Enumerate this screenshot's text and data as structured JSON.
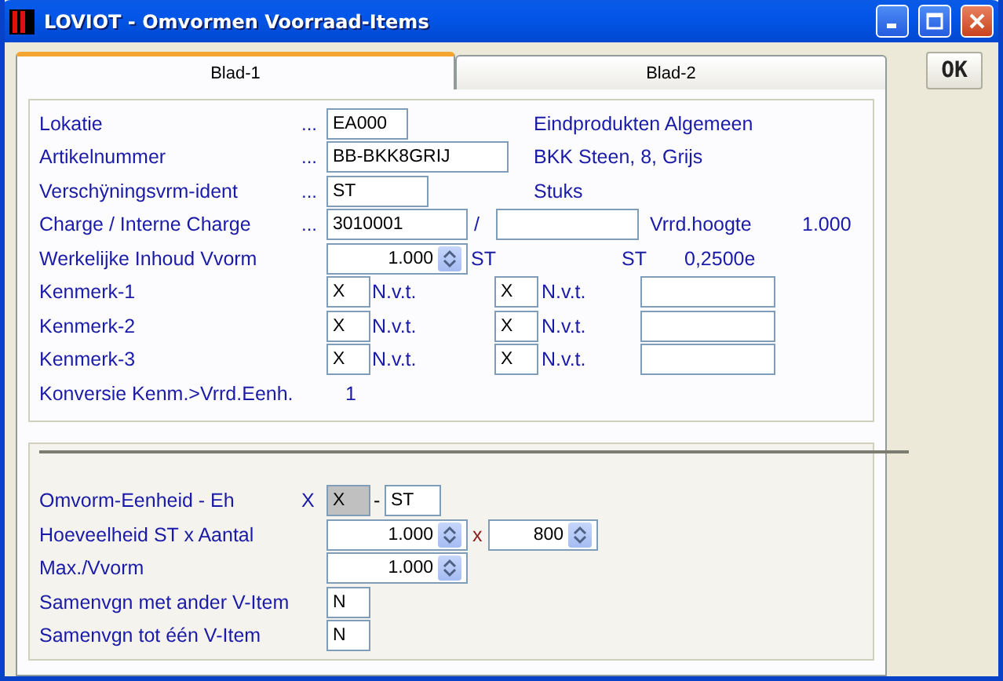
{
  "window": {
    "title": "LOVIOT - Omvormen Voorraad-Items"
  },
  "tabs": [
    {
      "label": "Blad-1",
      "selected": true
    },
    {
      "label": "Blad-2",
      "selected": false
    }
  ],
  "ok_button": {
    "label": "OK"
  },
  "upper_rows": [
    {
      "kind": "text",
      "label": "Lokatie",
      "dots": "...",
      "value": "EA000",
      "description": "Eindprodukten Algemeen"
    },
    {
      "kind": "text",
      "label": "Artikelnummer",
      "dots": "...",
      "value": "BB-BKK8GRIJ",
      "description": "BKK Steen, 8, Grijs"
    },
    {
      "kind": "text",
      "label": "Verschÿningsvrm-ident",
      "dots": "...",
      "value": "ST",
      "description": "Stuks"
    },
    {
      "kind": "charge",
      "label": "Charge / Interne Charge",
      "dots": "...",
      "value": "3010001",
      "separator": "/",
      "extra_label": "Vrrd.hoogte",
      "extra_value": "1.000"
    },
    {
      "kind": "spin",
      "label": "Werkelijke Inhoud Vvorm",
      "value": "1.000",
      "unit": "ST",
      "unit_2": "ST",
      "factor": "0,2500e"
    },
    {
      "kind": "kenmerk",
      "label": "Kenmerk-1",
      "code_1": "X",
      "text_1": "N.v.t.",
      "code_2": "X",
      "text_2": "N.v.t."
    },
    {
      "kind": "kenmerk",
      "label": "Kenmerk-2",
      "code_1": "X",
      "text_1": "N.v.t.",
      "code_2": "X",
      "text_2": "N.v.t."
    },
    {
      "kind": "kenmerk",
      "label": "Kenmerk-3",
      "code_1": "X",
      "text_1": "N.v.t.",
      "code_2": "X",
      "text_2": "N.v.t."
    },
    {
      "kind": "konversie",
      "label": "Konversie Kenm.>Vrrd.Eenh.",
      "value": "1"
    }
  ],
  "lower_rows": [
    {
      "kind": "eenheid",
      "label": "Omvorm-Eenheid - Eh",
      "prefix": "X",
      "value": "X",
      "disabled": true,
      "separator": "-",
      "value_2": "ST"
    },
    {
      "kind": "product",
      "label": "Hoeveelheid ST x Aantal",
      "value": "1.000",
      "operator": "x",
      "value_2": "800"
    },
    {
      "kind": "spin",
      "label": "Max./Vvorm",
      "value": "1.000"
    },
    {
      "kind": "text",
      "label": "Samenvgn met ander V-Item",
      "value": "N"
    },
    {
      "kind": "text",
      "label": "Samenvgn tot één V-Item",
      "value": "N"
    }
  ]
}
